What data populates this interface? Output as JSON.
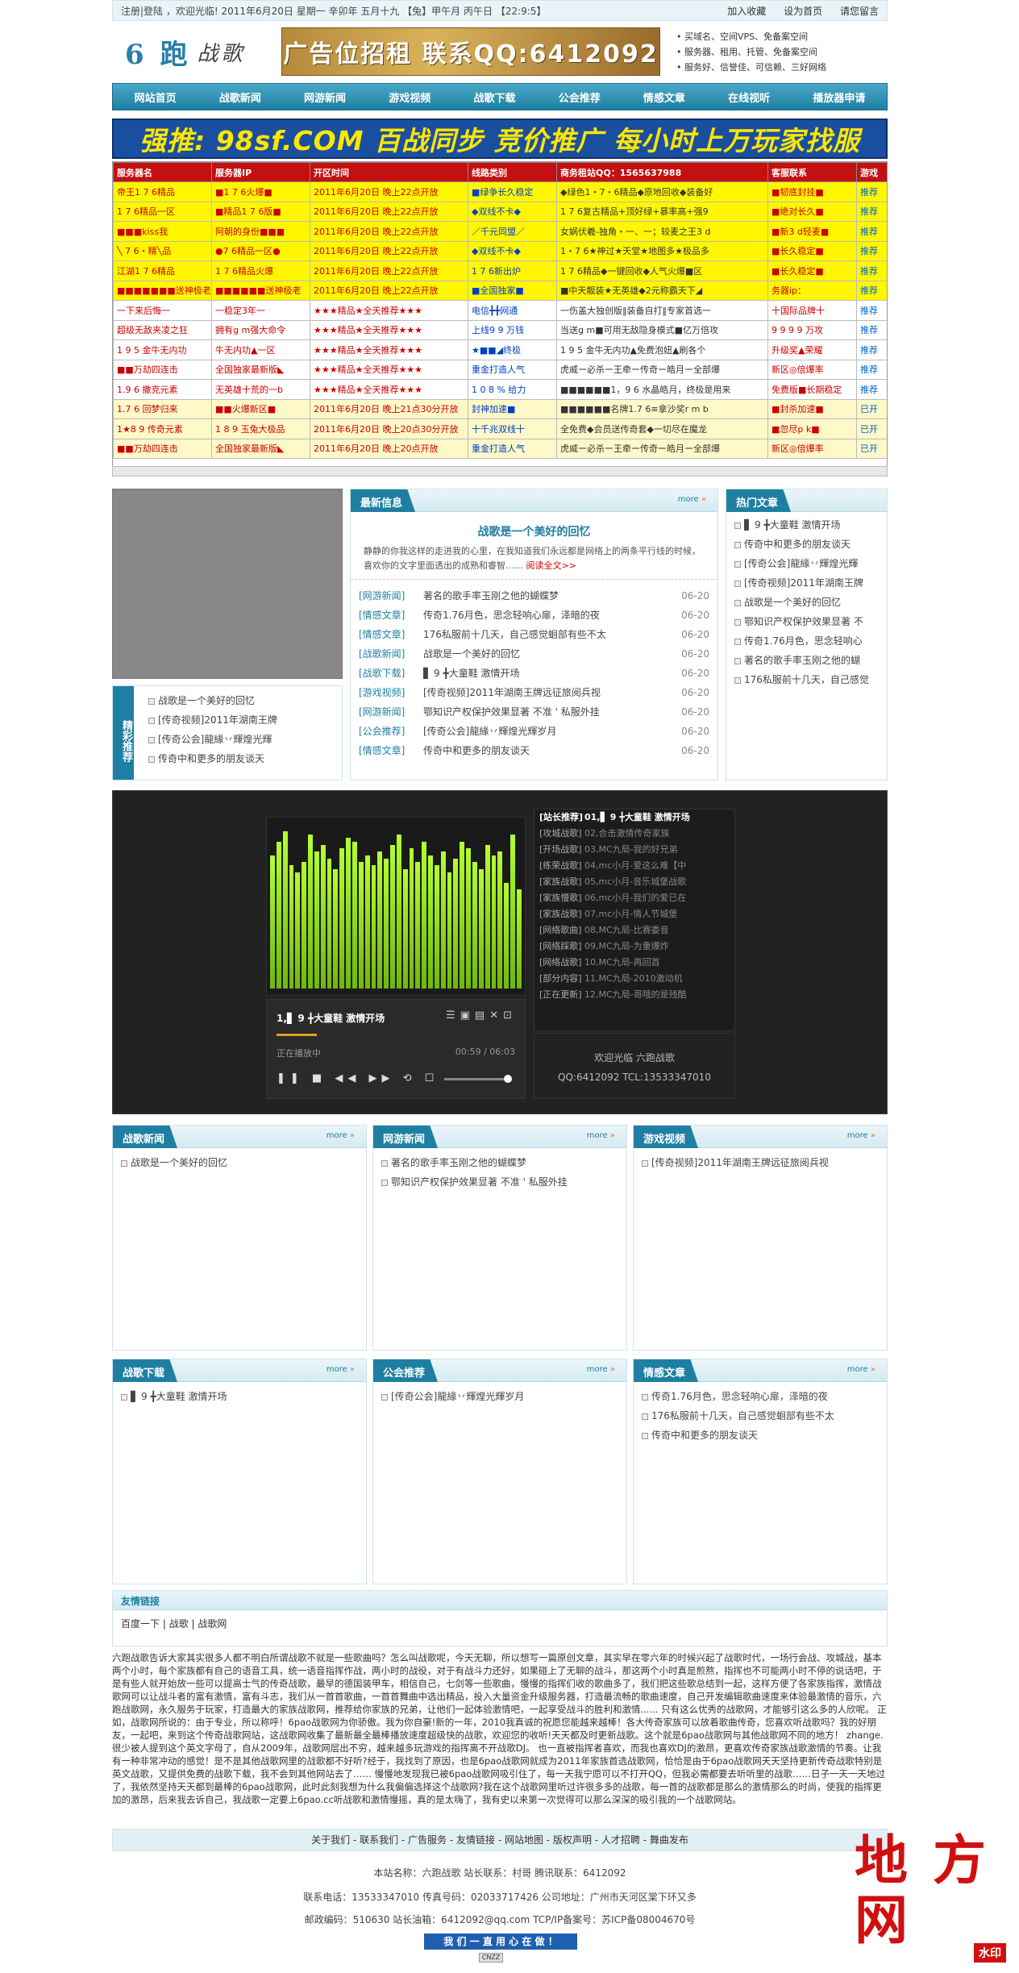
{
  "topbar": {
    "welcome": "注册|登陆 ，欢迎光临! 2011年6月20日 星期一  辛卯年 五月十九 【兔】甲午月 丙午日 【22:9:5】",
    "links": [
      "加入收藏",
      "设为首页",
      "请您留言"
    ]
  },
  "header": {
    "logo_main": "6 跑",
    "logo_sub": "战歌",
    "ad": "广告位招租 联系QQ:6412092",
    "services": [
      "买域名、空间VPS、免备案空间",
      "服务器、租用、托管、免备案空间",
      "服务好、信誉佳、可信赖、三好网络"
    ]
  },
  "nav": [
    "网站首页",
    "战歌新闻",
    "网游新闻",
    "游戏视频",
    "战歌下载",
    "公会推荐",
    "情感文章",
    "在线视听",
    "播放器申请"
  ],
  "promo": "强推: 98sf.COM 百战同步 竞价推广 每小时上万玩家找服",
  "servers": {
    "headers": [
      "服务器名",
      "服务器IP",
      "开区时间",
      "线路类别",
      "商务租站QQ：1565637988",
      "客服联系",
      "游戏"
    ],
    "rows": [
      {
        "style": "y",
        "c": [
          "帝王1 7 6精品",
          "■1 7 6火爆■",
          "2011年6月20日 晚上22点开放",
          "■绿争长久稳定",
          "◆绿色1・7・6精品◆原地回收◆装备好",
          "■韧底封挂■",
          "推荐"
        ]
      },
      {
        "style": "y",
        "c": [
          "1 7 6精品一区",
          "■精品1 7 6版■",
          "2011年6月20日 晚上22点开放",
          "◆双线不卡◆",
          "1 7 6复古精品+顶好绿+暴率高+强9",
          "■绝对长久■",
          "推荐"
        ]
      },
      {
        "style": "y",
        "c": [
          "■■■kiss我",
          "阿朝的身份■■■",
          "2011年6月20日 晚上22点开放",
          "／千元同盟／",
          "女娲伏羲-独角・一、一；较麦之王3 d",
          "■新3 d轻麦■",
          "推荐"
        ]
      },
      {
        "style": "y",
        "c": [
          "╲ 7 6・精╲品",
          "●7 6精品一区●",
          "2011年6月20日 晚上22点开放",
          "◆双线不卡◆",
          "1・7 6★神过★天堂★地图多★极品多",
          "■长久稳定■",
          "推荐"
        ]
      },
      {
        "style": "y",
        "c": [
          "江湖1 7 6精品",
          "1 7 6精品火爆",
          "2011年6月20日 晚上22点开放",
          "1 7 6新出炉",
          "1 7 6精品◆一键回收◆人气火爆■区",
          "■长久稳定■",
          "推荐"
        ]
      },
      {
        "style": "y",
        "c": [
          "■■■■■■■送神极老",
          "■■■■■■送神极老",
          "2011年6月20日 晚上22点开放",
          "■全国独家■",
          "■中天靓装★无英雄◆2元称霸天下◢",
          "务器ip：",
          "推荐"
        ]
      },
      {
        "style": "w",
        "c": [
          "一下来后悔一",
          "一稳定3年一",
          "★★★精品★全天推荐★★★",
          "电信╋╋网通",
          "一伤盖大独创版‖装备自打‖专家首选一",
          "十国际品牌十",
          "推荐"
        ]
      },
      {
        "style": "w",
        "c": [
          "超级无敌夹凌之狂",
          "拥有g m强大命令",
          "★★★精品★全天推荐★★★",
          "上线9 9 万钱",
          "当送g m■可用无敌隐身模式■亿万倍攻",
          "9 9 9 9 万攻",
          "推荐"
        ]
      },
      {
        "style": "w",
        "c": [
          "1 9 5 金牛无内功",
          "牛无内功▲一区",
          "★★★精品★全天推荐★★★",
          "★■■◢终极",
          "1 9 5 金牛无内功▲免费泡妞▲刷各个",
          "升级奖▲荣耀",
          "推荐"
        ]
      },
      {
        "style": "w",
        "c": [
          "■■万劫四连击",
          "全国独家最新版◣",
          "★★★精品★全天推荐★★★",
          "重金打造人气",
          "虎威ー必杀ー王牵ー传奇ー皓月ー全部爆",
          "新区◎倍爆率",
          "推荐"
        ]
      },
      {
        "style": "w",
        "c": [
          "1.9 6 撒克元素",
          "无英雄十荒的一b",
          "★★★精品★全天推荐★★★",
          "1 0 8 % 给力",
          "■■■■■■1，9 6 水晶皓月，终极是用来",
          "免费版■长期稳定",
          "推荐"
        ]
      },
      {
        "style": "p",
        "c": [
          "1.7 6 回梦归来",
          "■■火爆新区■",
          "2011年6月20日 晚上21点30分开放",
          "封神加速■",
          "■■■■■■名牌1.7 6≡拿沙奖r m b",
          "■封杀加速■",
          "已开"
        ]
      },
      {
        "style": "p",
        "c": [
          "1★8 9 传奇元素",
          "1 8 9 玉兔大极品",
          "2011年6月20日 晚上20点30分开放",
          "十千兆双线十",
          "全免费◆会员送传奇套◆一切尽在魔龙",
          "■忽尽p k■",
          "已开"
        ]
      },
      {
        "style": "p",
        "c": [
          "■■万劫四连击",
          "全国独家最新版◣",
          "2011年6月20日 晚上20点开放",
          "重金打造人气",
          "虎威ー必杀ー王牵ー传奇ー皓月ー全部爆",
          "新区◎倍爆率",
          "已开"
        ]
      }
    ]
  },
  "featured": {
    "tab": "精彩推荐",
    "items": [
      "战歌是一个美好的回忆",
      "[传奇视频]2011年湖南王牌",
      "[传奇公会]龍緣丷輝煌光輝",
      "传奇中和更多的朋友谈天"
    ]
  },
  "latest": {
    "tab": "最新信息",
    "more": "more",
    "headline": "战歌是一个美好的回忆",
    "summary": "静静的你我这样的走进我的心里，在我知道我们永远都是网络上的两条平行线的时候，喜欢你的文字里面透出的成熟和睿智……",
    "read_more": "阅读全文>>",
    "rows": [
      {
        "cat": "[网游新闻]",
        "title": "著名的歌手率玉刚之他的蝴蝶梦",
        "date": "06-20"
      },
      {
        "cat": "[情感文章]",
        "title": "传奇1.76月色，思念轻响心扉，泽暗的夜",
        "date": "06-20"
      },
      {
        "cat": "[情感文章]",
        "title": "176私服前十几天，自己感觉蛔部有些不太",
        "date": "06-20"
      },
      {
        "cat": "[战歌新闻]",
        "title": "战歌是一个美好的回忆",
        "date": "06-20"
      },
      {
        "cat": "[战歌下载]",
        "title": "▋ 9 ╋大童鞋  激情开场",
        "date": "06-20"
      },
      {
        "cat": "[游戏视频]",
        "title": "[传奇视频]2011年湖南王牌远征旅阅兵视",
        "date": "06-20"
      },
      {
        "cat": "[网游新闻]",
        "title": "鄂知识产权保护效果显著 不准 ' 私服外挂",
        "date": "06-20"
      },
      {
        "cat": "[公会推荐]",
        "title": "[传奇公会]龍緣丷輝煌光輝岁月",
        "date": "06-20"
      },
      {
        "cat": "[情感文章]",
        "title": "传奇中和更多的朋友谈天",
        "date": "06-20"
      }
    ]
  },
  "hot": {
    "tab": "热门文章",
    "items": [
      "▋ 9 ╋大童鞋  激情开场",
      "传奇中和更多的朋友谈天",
      "[传奇公会]龍緣丷輝煌光輝",
      "[传奇视频]2011年湖南王牌",
      "战歌是一个美好的回忆",
      "鄂知识产权保护效果显著 不",
      "传奇1.76月色，思念轻响心",
      "著名的歌手率玉刚之他的蝴",
      "176私服前十几天，自己感觉"
    ]
  },
  "player": {
    "playlist": [
      {
        "c": "[站长推荐]",
        "s": "01,▋ 9 ╋大童鞋  激情开场"
      },
      {
        "c": "[攻城战歌]",
        "s": "02,合击激情传奇家族"
      },
      {
        "c": "[开场战歌]",
        "s": "03,MC九局-我的好兄弟"
      },
      {
        "c": "[练荣战歌]",
        "s": "04,mc小月-爱这么难【中"
      },
      {
        "c": "[家族战歌]",
        "s": "05,mc小月-音乐城堡战歌"
      },
      {
        "c": "[家族慢歌]",
        "s": "06,mc小月-我们的爱已在"
      },
      {
        "c": "[家族战歌]",
        "s": "07,mc小月-情人节城堡"
      },
      {
        "c": "[网络歌曲]",
        "s": "08,MC九局-比赛委音"
      },
      {
        "c": "[网络踩歌]",
        "s": "09,MC九局-为重爆炸"
      },
      {
        "c": "[网络战歌]",
        "s": "10,MC九局-再回首"
      },
      {
        "c": "[部分内容]",
        "s": "11,MC九局-2010激动机"
      },
      {
        "c": "[正在更新]",
        "s": "12,MC九局-哥哦的是残酷"
      }
    ],
    "now_playing": "1,▋ 9 ╋大童鞋  激情开场",
    "status": "正在播放中",
    "time": "00:59 / 06:03",
    "welcome": "欢迎光临 六跑战歌",
    "contact": "QQ:6412092 TCL:13533347010",
    "eq_levels": [
      0.78,
      0.86,
      0.92,
      0.72,
      0.68,
      0.74,
      0.9,
      0.8,
      0.84,
      0.76,
      0.7,
      0.82,
      0.88,
      0.86,
      0.74,
      0.78,
      0.72,
      0.8,
      0.76,
      0.84,
      0.9,
      0.7,
      0.82,
      0.74,
      0.86,
      0.78,
      0.72,
      0.8,
      0.68,
      0.76,
      0.86,
      0.82,
      0.74,
      0.7,
      0.84,
      0.78,
      0.8,
      0.62,
      0.9,
      0.58
    ]
  },
  "sections": [
    {
      "tab": "战歌新闻",
      "more": "more",
      "items": [
        "战歌是一个美好的回忆"
      ]
    },
    {
      "tab": "网游新闻",
      "more": "more",
      "items": [
        "著名的歌手率玉刚之他的蝴蝶梦",
        "鄂知识产权保护效果显著 不准 ' 私服外挂"
      ]
    },
    {
      "tab": "游戏视频",
      "more": "more",
      "items": [
        "[传奇视频]2011年湖南王牌远征旅阅兵视"
      ]
    },
    {
      "tab": "战歌下载",
      "more": "more",
      "items": [
        "▋ 9 ╋大童鞋  激情开场"
      ]
    },
    {
      "tab": "公会推荐",
      "more": "more",
      "items": [
        "[传奇公会]龍緣丷輝煌光輝岁月"
      ]
    },
    {
      "tab": "情感文章",
      "more": "more",
      "items": [
        "传奇1.76月色，思念轻响心扉，泽暗的夜",
        "176私服前十几天，自己感觉蛔部有些不太",
        "传奇中和更多的朋友谈天"
      ]
    }
  ],
  "friends": {
    "title": "友情链接",
    "links": [
      "百度一下",
      "战歌",
      "战歌网"
    ]
  },
  "about": "六跑战歌告诉大家其实很多人都不明白所谓战歌不就是一些歌曲吗？怎么叫战歌呢，今天无聊，所以想写一篇原创文章，其实早在零六年的时候兴起了战歌时代，一场行会战、攻城战，基本两个小时，每个家族都有自己的语音工具，统一语音指挥作战，两小时的战役，对于有战斗力还好，如果碰上了无聊的战斗，那这两个小时真是煎熬，指挥也不可能两小时不停的说话吧，于是有些人就开始放一些可以提高士气的传奇战歌，最早的德国装甲车，相信自己，七剑等一些歌曲，慢慢的指挥们收的歌曲多了，我们把这些歌总结到一起，这样方便了各家族指挥，激情战歌网可以让战斗者的富有激情，富有斗志，我们从一首首歌曲，一首首舞曲中选出精品，投入大量资金升级服务器，打造最流畅的歌曲速度，自己开发编辑歌曲速度来体验最激情的音乐，六跑战歌网，永久服务于玩家，打造最大的家族战歌网，推荐给你家族的兄弟，让他们一起体验激情吧，一起享受战斗的胜利和激情...... 只有这么优秀的战歌网，才能够引这么多的人欣呢。 正如，战歌网所说的：由于专业，所以称呼！6pao战歌网为你骄傲。我为你自豪!新的一年，2010我真诚的祝愿您能越来越棒！各大传奇家族可以放着歌曲传奇，您喜欢听战歌吗？我的好朋友，一起吧，来到这个传奇战歌网站，这战歌网收集了最新最全最棒播放速度超级快的战歌，欢迎您的收听!天天都及时更新战歌。这个就是6pao战歌网与其他战歌网不同的地方！ zhange. 很少被人提到这个英文字母了，自从2009年，战歌网层出不穷，越来越多玩游戏的指挥离不开战歌DJ。 也一直被指挥者喜欢，而我也喜欢DJ的激昂，更喜欢传奇家族战歌激情的节奏。让我有一种非常冲动的感觉！是不是其他战歌网里的战歌都不好听?经于，我找到了原因，也是6pao战歌网就成为2011年家族首选战歌网，恰恰是由于6pao战歌网天天坚持更新传奇战歌特别是英文战歌，又提供免费的战歌下载，我不会到其他网站去了…… 慢慢地发现我已被6pao战歌网吸引住了，每一天我宁愿可以不打开QQ，但我必需都要去听听里的战歌……日子一天一天地过了，我依然坚持天天都到最棒的6pao战歌网，此时此刻我想为什么我偏偏选择这个战歌网?我在这个战歌网里听过许很多多的战歌，每一首的战歌都是那么的激情那么的时尚，使我的指挥更加的激昂，后来我去诉自己，我战歌一定要上6pao.cc听战歌和激情慢摇，真的是太嗨了，我有史以来第一次觉得可以那么深深的吸引我的一个战歌网站。",
  "footer": {
    "links": "关于我们 - 联系我们 - 广告服务 - 友情链接 - 网站地图 - 版权声明 - 人才招聘 - 舞曲发布",
    "line1": "本站名称：六跑战歌  站长联系：村哥  腾讯联系：6412092",
    "line2": "联系电话：13533347010  传真号码：02033717426  公司地址：广州市天河区棠下环又多",
    "line3": "邮政编码：510630  站长油箱：6412092@qq.com  TCP/IP备案号：苏ICP备08004670号",
    "badge": "我 们 一 直 用 心 在 做 ！",
    "cnzz": "CNZZ"
  },
  "watermark": {
    "chars": "地 方 网",
    "tag": "水印"
  }
}
